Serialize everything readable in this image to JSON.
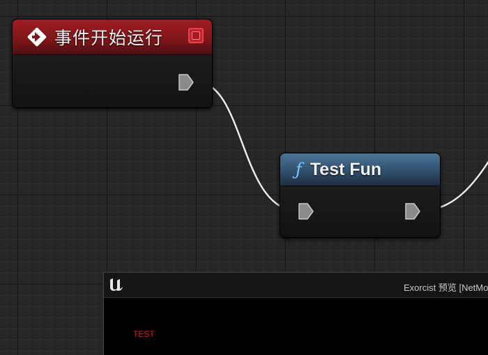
{
  "graph": {
    "event_node": {
      "title": "事件开始运行",
      "icon": "event-diamond-icon",
      "header_color": "#9e1d22"
    },
    "function_node": {
      "icon_glyph": "ƒ",
      "title": "Test Fun",
      "header_color": "#30506e"
    },
    "wire_color": "#f0f0f0",
    "exec_pin_color": "#8a8a8a"
  },
  "viewport_window": {
    "logo": "unreal-logo-icon",
    "title": "Exorcist 预览 [NetMo",
    "debug_message": "TEST",
    "debug_color": "#e21a1a"
  }
}
